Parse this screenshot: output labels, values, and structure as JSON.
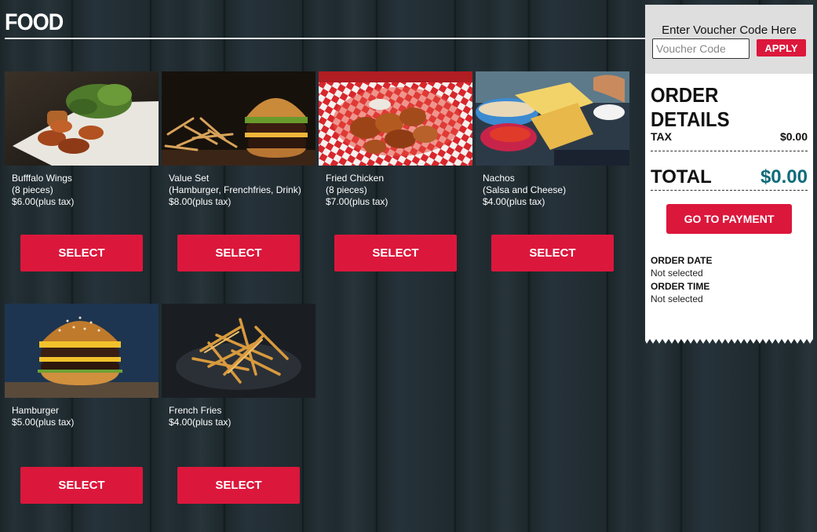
{
  "section": {
    "title": "FOOD"
  },
  "items": [
    {
      "name": "Bufffalo Wings",
      "desc": "(8 pieces)",
      "price": "$6.00(plus tax)",
      "select_label": "SELECT",
      "image": "buffalo-wings-photo"
    },
    {
      "name": "Value Set",
      "desc": "(Hamburger, Frenchfries, Drink)",
      "price": "$8.00(plus tax)",
      "select_label": "SELECT",
      "image": "value-set-photo"
    },
    {
      "name": "Fried Chicken",
      "desc": "(8 pieces)",
      "price": "$7.00(plus tax)",
      "select_label": "SELECT",
      "image": "fried-chicken-photo"
    },
    {
      "name": "Nachos",
      "desc": "(Salsa and Cheese)",
      "price": "$4.00(plus tax)",
      "select_label": "SELECT",
      "image": "nachos-photo"
    },
    {
      "name": "Hamburger",
      "price": "$5.00(plus tax)",
      "select_label": "SELECT",
      "image": "hamburger-photo"
    },
    {
      "name": "French Fries",
      "price": "$4.00(plus tax)",
      "select_label": "SELECT",
      "image": "french-fries-photo"
    }
  ],
  "order": {
    "voucher_label": "Enter Voucher Code Here",
    "voucher_placeholder": "Voucher Code",
    "apply_label": "APPLY",
    "title": "ORDER DETAILS",
    "tax_label": "TAX",
    "tax_value": "$0.00",
    "total_label": "TOTAL",
    "total_value": "$0.00",
    "payment_label": "GO TO PAYMENT",
    "date_label": "ORDER DATE",
    "date_value": "Not selected",
    "time_label": "ORDER TIME",
    "time_value": "Not selected"
  },
  "colors": {
    "accent": "#dc173c",
    "total": "#0f6c7a",
    "background": "#1f2a2f"
  }
}
